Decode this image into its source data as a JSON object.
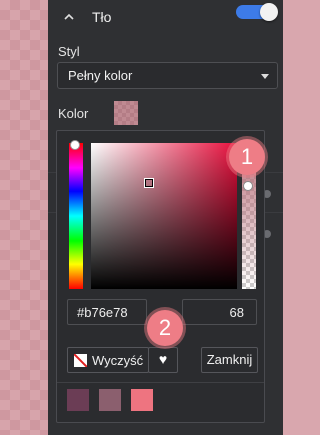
{
  "section": {
    "title": "Tło",
    "toggle_on": true,
    "style_label": "Styl",
    "style_value": "Pełny kolor",
    "color_label": "Kolor"
  },
  "color_picker": {
    "hex_value": "#b76e78",
    "alpha_value": "68",
    "clear_label": "Wyczyść",
    "close_label": "Zamknij",
    "favorite_icon": "heart-icon",
    "recent_colors": [
      "#6b3d55",
      "#8b5f6e",
      "#ee7480"
    ]
  },
  "annotations": {
    "badge_1": "1",
    "badge_2": "2"
  },
  "colors": {
    "accent": "#3d7be8",
    "badge": "#ee7d86",
    "panel_bg": "#2f3033"
  }
}
